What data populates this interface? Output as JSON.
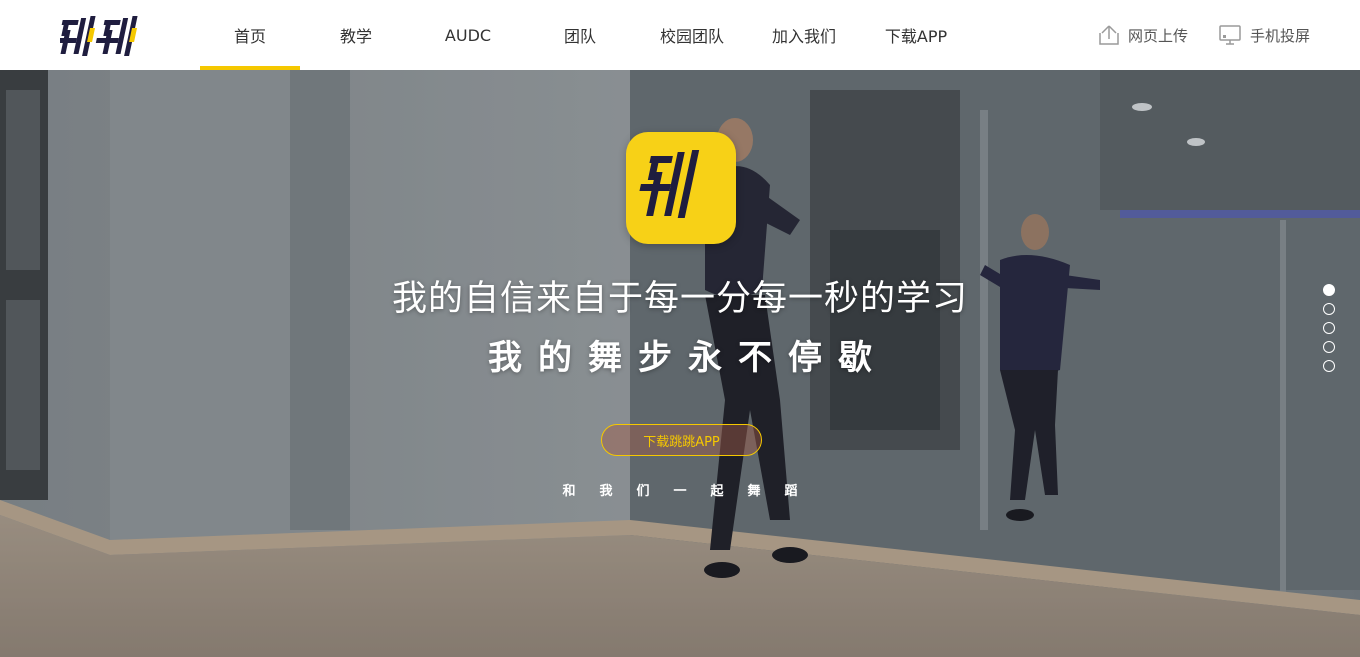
{
  "brand": {
    "logo_name": "跳跳",
    "accent_color": "#f5c800",
    "dark_color": "#1f1d3f"
  },
  "nav": {
    "items": [
      {
        "label": "首页",
        "active": true
      },
      {
        "label": "教学",
        "active": false
      },
      {
        "label": "AUDC",
        "active": false
      },
      {
        "label": "团队",
        "active": false
      },
      {
        "label": "校园团队",
        "active": false
      },
      {
        "label": "加入我们",
        "active": false
      },
      {
        "label": "下载APP",
        "active": false
      }
    ]
  },
  "header_actions": {
    "upload": {
      "label": "网页上传",
      "icon": "upload-icon"
    },
    "cast": {
      "label": "手机投屏",
      "icon": "monitor-icon"
    }
  },
  "hero": {
    "headline": "我的自信来自于每一分每一秒的学习",
    "subline": "我的舞步永不停歇",
    "cta_label": "下载跳跳APP",
    "tagline": "和我们一起舞蹈",
    "slides": {
      "count": 5,
      "active_index": 0
    }
  }
}
